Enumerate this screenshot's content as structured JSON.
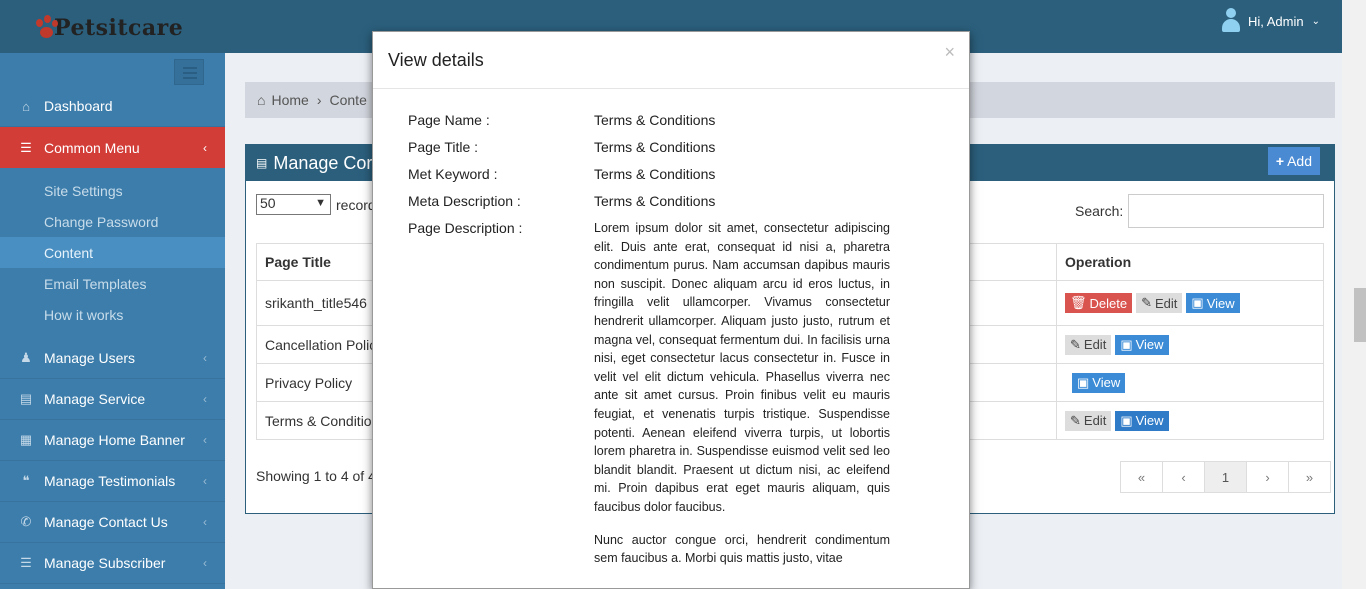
{
  "header": {
    "logo_text": "Petsitcare",
    "user_label": "Hi, Admin"
  },
  "sidebar": {
    "items": [
      {
        "label": "Dashboard",
        "icon": "home-icon"
      },
      {
        "label": "Common Menu",
        "icon": "list-icon"
      },
      {
        "label": "Manage Users",
        "icon": "users-icon"
      },
      {
        "label": "Manage Service",
        "icon": "list-alt-icon"
      },
      {
        "label": "Manage Home Banner",
        "icon": "image-icon"
      },
      {
        "label": "Manage Testimonials",
        "icon": "quote-icon"
      },
      {
        "label": "Manage Contact Us",
        "icon": "phone-icon"
      },
      {
        "label": "Manage Subscriber",
        "icon": "server-icon"
      }
    ],
    "submenu": [
      "Site Settings",
      "Change Password",
      "Content",
      "Email Templates",
      "How it works"
    ]
  },
  "breadcrumb": {
    "home": "Home",
    "current": "Conte"
  },
  "panel": {
    "title": "Manage Cor",
    "add_label": "Add",
    "page_size": "50",
    "records_label": "record",
    "search_label": "Search:",
    "columns": {
      "title": "Page Title",
      "operation": "Operation"
    },
    "rows": [
      {
        "title": "srikanth_title546"
      },
      {
        "title": "Cancellation Polici"
      },
      {
        "title": "Privacy Policy"
      },
      {
        "title": "Terms & Condition"
      }
    ],
    "buttons": {
      "delete": "Delete",
      "edit": "Edit",
      "view": "View"
    },
    "showing": "Showing 1 to 4 of 4",
    "pager": {
      "first": "«",
      "prev": "‹",
      "current": "1",
      "next": "›",
      "last": "»"
    }
  },
  "modal": {
    "title": "View details",
    "close": "×",
    "fields": [
      {
        "label": "Page Name :",
        "value": "Terms & Conditions"
      },
      {
        "label": "Page Title :",
        "value": "Terms & Conditions"
      },
      {
        "label": "Met Keyword :",
        "value": "Terms & Conditions"
      },
      {
        "label": "Meta Description :",
        "value": "Terms & Conditions"
      },
      {
        "label": "Page Description :",
        "value": ""
      }
    ],
    "description_p1": "Lorem ipsum dolor sit amet, consectetur adipiscing elit. Duis ante erat, consequat id nisi a, pharetra condimentum purus. Nam accumsan dapibus mauris non suscipit. Donec aliquam arcu id eros luctus, in fringilla velit ullamcorper. Vivamus consectetur hendrerit ullamcorper. Aliquam justo justo, rutrum et magna vel, consequat fermentum dui. In facilisis urna nisi, eget consectetur lacus consectetur in. Fusce in velit vel elit dictum vehicula. Phasellus viverra nec ante sit amet cursus. Proin finibus velit eu mauris feugiat, et venenatis turpis tristique. Suspendisse potenti. Aenean eleifend viverra turpis, ut lobortis lorem pharetra in. Suspendisse euismod velit sed leo blandit blandit. Praesent ut dictum nisi, ac eleifend mi. Proin dapibus erat eget mauris aliquam, quis faucibus dolor faucibus.",
    "description_p2": "Nunc auctor congue orci, hendrerit condimentum sem faucibus a. Morbi quis mattis justo, vitae"
  }
}
